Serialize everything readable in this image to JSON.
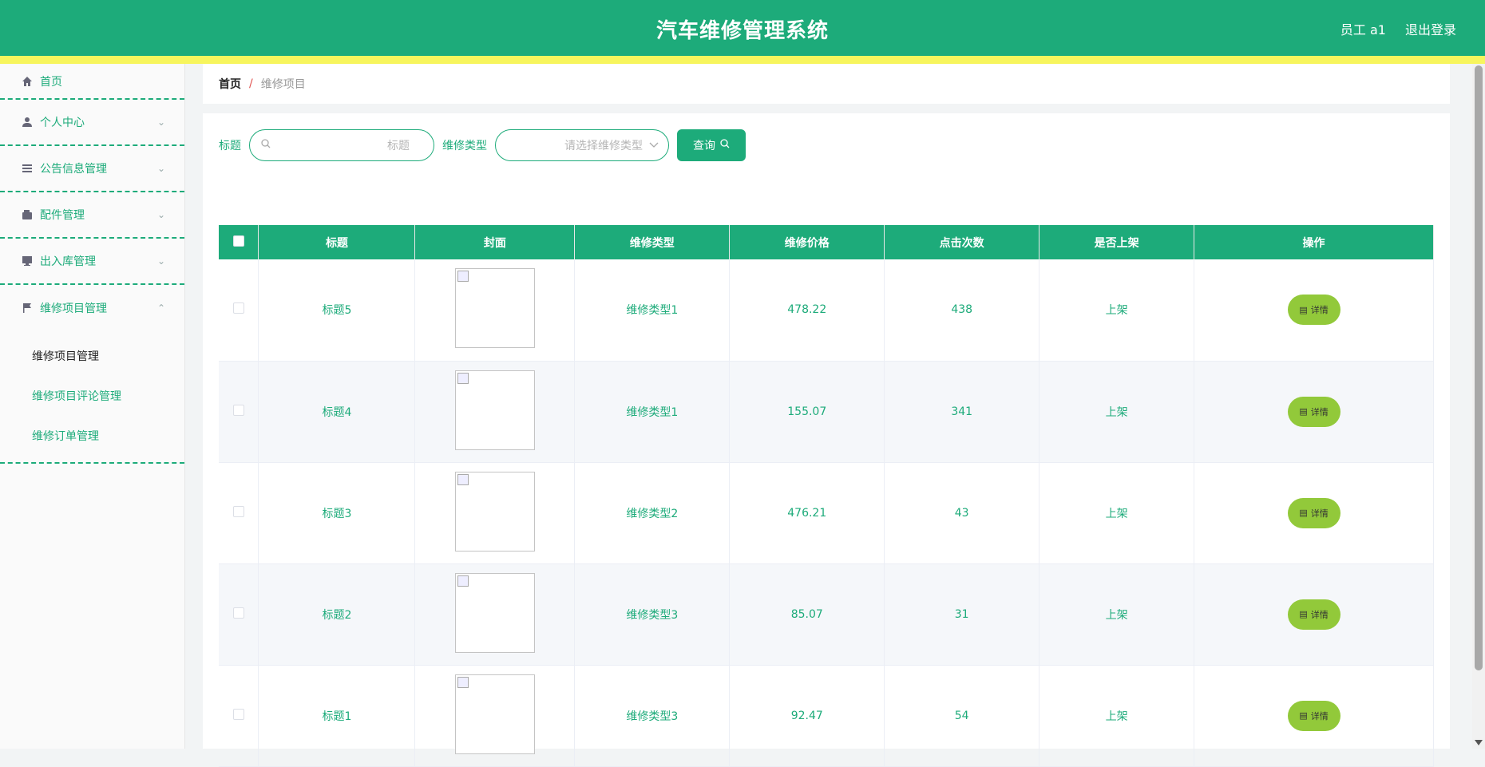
{
  "header": {
    "title": "汽车维修管理系统",
    "user": "员工 a1",
    "logout": "退出登录"
  },
  "sidebar": {
    "items": [
      {
        "label": "首页",
        "icon": "home-icon"
      },
      {
        "label": "个人中心",
        "icon": "user-icon"
      },
      {
        "label": "公告信息管理",
        "icon": "list-icon"
      },
      {
        "label": "配件管理",
        "icon": "wallet-icon"
      },
      {
        "label": "出入库管理",
        "icon": "monitor-icon"
      },
      {
        "label": "维修项目管理",
        "icon": "flag-icon"
      }
    ],
    "submenu": [
      "维修项目管理",
      "维修项目评论管理",
      "维修订单管理"
    ]
  },
  "breadcrumb": {
    "home": "首页",
    "separator": "/",
    "current": "维修项目"
  },
  "search": {
    "title_label": "标题",
    "title_placeholder": "标题",
    "type_label": "维修类型",
    "type_placeholder": "请选择维修类型",
    "query_label": "查询"
  },
  "table": {
    "headers": [
      "标题",
      "封面",
      "维修类型",
      "维修价格",
      "点击次数",
      "是否上架",
      "操作"
    ],
    "detail_label": "详情",
    "rows": [
      {
        "title": "标题5",
        "type": "维修类型1",
        "price": "478.22",
        "clicks": "438",
        "status": "上架"
      },
      {
        "title": "标题4",
        "type": "维修类型1",
        "price": "155.07",
        "clicks": "341",
        "status": "上架"
      },
      {
        "title": "标题3",
        "type": "维修类型2",
        "price": "476.21",
        "clicks": "43",
        "status": "上架"
      },
      {
        "title": "标题2",
        "type": "维修类型3",
        "price": "85.07",
        "clicks": "31",
        "status": "上架"
      },
      {
        "title": "标题1",
        "type": "维修类型3",
        "price": "92.47",
        "clicks": "54",
        "status": "上架"
      }
    ]
  },
  "colors": {
    "primary": "#1dab7a",
    "accent_stripe": "#f7f55d",
    "detail_button": "#92c93a"
  }
}
